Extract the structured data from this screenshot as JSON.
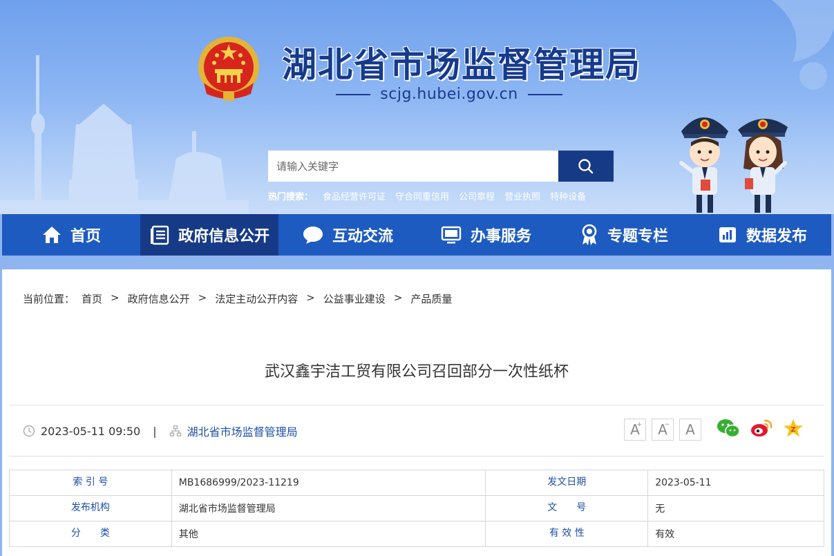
{
  "header": {
    "title": "湖北省市场监督管理局",
    "domain": "scjg.hubei.gov.cn"
  },
  "search": {
    "placeholder": "请输入关键字",
    "hot_label": "热门搜索：",
    "hot_items": [
      "食品经营许可证",
      "守合同重信用",
      "公司章程",
      "营业执照",
      "特种设备"
    ]
  },
  "nav": {
    "items": [
      {
        "label": "首页",
        "icon": "home-icon"
      },
      {
        "label": "政府信息公开",
        "icon": "document-list-icon"
      },
      {
        "label": "互动交流",
        "icon": "chat-bubble-icon"
      },
      {
        "label": "办事服务",
        "icon": "monitor-icon"
      },
      {
        "label": "专题专栏",
        "icon": "award-ribbon-icon"
      },
      {
        "label": "数据发布",
        "icon": "bar-chart-icon"
      }
    ],
    "active_index": 1
  },
  "breadcrumb": {
    "prefix": "当前位置：",
    "items": [
      "首页",
      "政府信息公开",
      "法定主动公开内容",
      "公益事业建设",
      "产品质量"
    ],
    "separator": ">"
  },
  "article": {
    "title": "武汉鑫宇洁工贸有限公司召回部分一次性纸杯",
    "datetime": "2023-05-11 09:50",
    "divider": "|",
    "source": "湖北省市场监督管理局"
  },
  "font_tools": [
    "A",
    "A",
    "A"
  ],
  "info": {
    "rows": [
      {
        "k1": "索 引 号",
        "v1": "MB1686999/2023-11219",
        "k2": "发文日期",
        "v2": "2023-05-11"
      },
      {
        "k1": "发布机构",
        "v1": "湖北省市场监督管理局",
        "k2": "文　　号",
        "v2": "无"
      },
      {
        "k1": "分　　类",
        "v1": "其他",
        "k2": "有 效 性",
        "v2": "有效"
      }
    ]
  },
  "colors": {
    "nav_bg": "#1e5bc0",
    "nav_active": "#163a86",
    "title_blue": "#163a8c",
    "link_blue": "#1c4fa5"
  }
}
